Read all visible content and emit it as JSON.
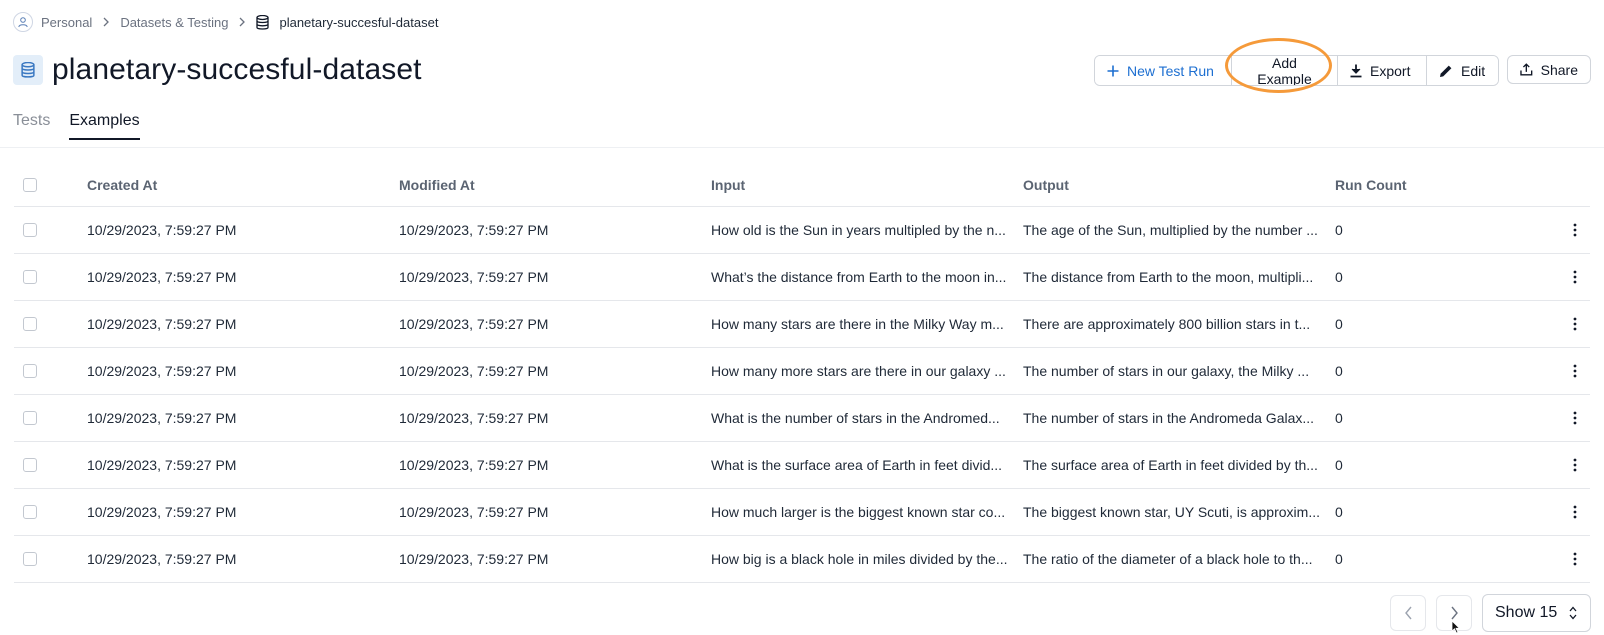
{
  "breadcrumb": {
    "personal": "Personal",
    "datasets": "Datasets & Testing",
    "current": "planetary-succesful-dataset"
  },
  "page": {
    "title": "planetary-succesful-dataset"
  },
  "actions": {
    "new_test_run": "New Test Run",
    "add_example": "Add Example",
    "export": "Export",
    "edit": "Edit",
    "share": "Share"
  },
  "tabs": [
    {
      "label": "Tests",
      "active": false
    },
    {
      "label": "Examples",
      "active": true
    }
  ],
  "table": {
    "columns": {
      "created": "Created At",
      "modified": "Modified At",
      "input": "Input",
      "output": "Output",
      "run_count": "Run Count"
    },
    "rows": [
      {
        "created": "10/29/2023, 7:59:27 PM",
        "modified": "10/29/2023, 7:59:27 PM",
        "input": "How old is the Sun in years multipled by the n...",
        "output": "The age of the Sun, multiplied by the number ...",
        "run_count": "0"
      },
      {
        "created": "10/29/2023, 7:59:27 PM",
        "modified": "10/29/2023, 7:59:27 PM",
        "input": "What’s the distance from Earth to the moon in...",
        "output": "The distance from Earth to the moon, multipli...",
        "run_count": "0"
      },
      {
        "created": "10/29/2023, 7:59:27 PM",
        "modified": "10/29/2023, 7:59:27 PM",
        "input": "How many stars are there in the Milky Way m...",
        "output": "There are approximately 800 billion stars in t...",
        "run_count": "0"
      },
      {
        "created": "10/29/2023, 7:59:27 PM",
        "modified": "10/29/2023, 7:59:27 PM",
        "input": "How many more stars are there in our galaxy ...",
        "output": "The number of stars in our galaxy, the Milky ...",
        "run_count": "0"
      },
      {
        "created": "10/29/2023, 7:59:27 PM",
        "modified": "10/29/2023, 7:59:27 PM",
        "input": "What is the number of stars in the Andromed...",
        "output": "The number of stars in the Andromeda Galax...",
        "run_count": "0"
      },
      {
        "created": "10/29/2023, 7:59:27 PM",
        "modified": "10/29/2023, 7:59:27 PM",
        "input": "What is the surface area of Earth in feet divid...",
        "output": "The surface area of Earth in feet divided by th...",
        "run_count": "0"
      },
      {
        "created": "10/29/2023, 7:59:27 PM",
        "modified": "10/29/2023, 7:59:27 PM",
        "input": "How much larger is the biggest known star co...",
        "output": "The biggest known star, UY Scuti, is approxim...",
        "run_count": "0"
      },
      {
        "created": "10/29/2023, 7:59:27 PM",
        "modified": "10/29/2023, 7:59:27 PM",
        "input": "How big is a black hole in miles divided by the...",
        "output": "The ratio of the diameter of a black hole to th...",
        "run_count": "0"
      }
    ]
  },
  "pagination": {
    "show_label": "Show 15"
  },
  "colors": {
    "accent": "#1d6fd1",
    "highlight": "#f59a3a"
  }
}
